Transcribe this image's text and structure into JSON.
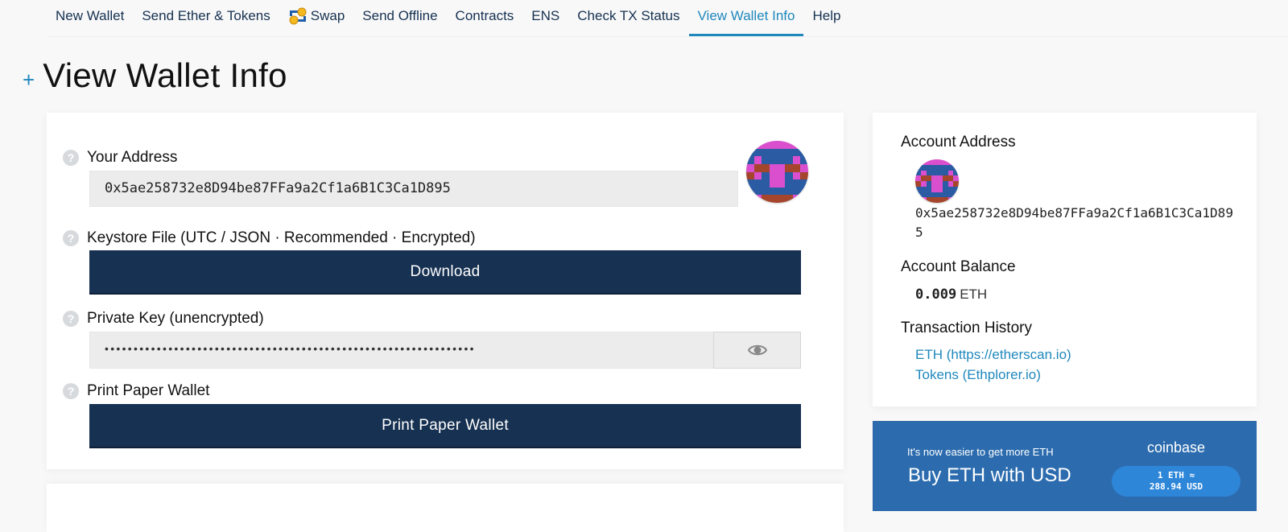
{
  "nav": {
    "items": [
      {
        "label": "New Wallet",
        "icon": null,
        "active": false
      },
      {
        "label": "Send Ether & Tokens",
        "icon": null,
        "active": false
      },
      {
        "label": "Swap",
        "icon": "swap-icon",
        "active": false
      },
      {
        "label": "Send Offline",
        "icon": null,
        "active": false
      },
      {
        "label": "Contracts",
        "icon": null,
        "active": false
      },
      {
        "label": "ENS",
        "icon": null,
        "active": false
      },
      {
        "label": "Check TX Status",
        "icon": null,
        "active": false
      },
      {
        "label": "View Wallet Info",
        "icon": null,
        "active": true
      },
      {
        "label": "Help",
        "icon": null,
        "active": false
      }
    ],
    "accent_color": "#1f88bd"
  },
  "page": {
    "plus": "+",
    "title": "View Wallet Info"
  },
  "wallet": {
    "address_label": "Your Address",
    "address": "0x5ae258732e8D94be87FFa9a2Cf1a6B1C3Ca1D895",
    "keystore_label": "Keystore File (UTC / JSON · Recommended · Encrypted)",
    "download_button": "Download",
    "private_key_label": "Private Key (unencrypted)",
    "private_key_masked": "••••••••••••••••••••••••••••••••••••••••••••••••••••••••••••••••",
    "print_label": "Print Paper Wallet",
    "print_button": "Print Paper Wallet",
    "help_glyph": "?",
    "button_color": "#163151"
  },
  "identicon": {
    "colors": {
      "B": "#2a5ba3",
      "P": "#da4fcd",
      "R": "#a4452c"
    },
    "rows": [
      "PPPPPPPP",
      "BBBBBBBB",
      "BPBBBBPB",
      "PRRPPRRP",
      "RPBPPBPR",
      "BBBPPBBB",
      "BBBBBBBB",
      "BPRRRRPB"
    ]
  },
  "sidebar": {
    "account_address_label": "Account Address",
    "account_address": "0x5ae258732e8D94be87FFa9a2Cf1a6B1C3Ca1D895",
    "balance_label": "Account Balance",
    "balance_value": "0.009",
    "balance_unit": "ETH",
    "history_label": "Transaction History",
    "links": [
      {
        "label": "ETH (https://etherscan.io)"
      },
      {
        "label": "Tokens (Ethplorer.io)"
      }
    ]
  },
  "coinbase": {
    "tagline": "It's now easier to get more ETH",
    "headline": "Buy ETH with USD",
    "brand": "coinbase",
    "rate_line1": "1 ETH ≈",
    "rate_line2": "288.94 USD",
    "bg_color": "#2c6cae"
  }
}
